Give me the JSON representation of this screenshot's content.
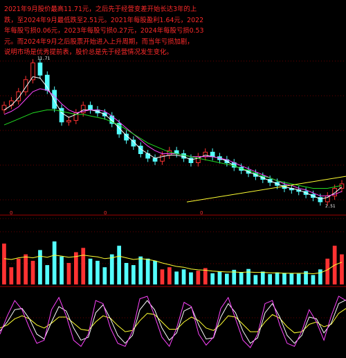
{
  "annotation": {
    "lines": [
      "2021年9月股价最高11.71元，之后先于经营变差开始长达3年的上",
      "跌，至2024年9月最低跌至2.51元。2021年每股盈利1.64元，2022",
      "年每股亏损0.06元，2023年每股亏损0.27元，2024年每股亏损0.53",
      "元。而2024年9月之后股票开始进入上升周期，而当年亏损加剧，",
      "说明市场是优秀提前表，股价总是先于经营情况发生变化。"
    ]
  },
  "chart_data": {
    "type": "line",
    "title": "",
    "price_labels": {
      "high": "11.71",
      "low": "2.51"
    },
    "year_markers": [
      "0",
      "0",
      "0"
    ],
    "price_panel": {
      "close": [
        8.9,
        9.2,
        9.8,
        10.6,
        11.71,
        10.9,
        9.9,
        8.7,
        7.8,
        7.9,
        8.4,
        8.9,
        8.6,
        8.4,
        8.2,
        7.7,
        7.0,
        6.6,
        6.2,
        5.7,
        5.4,
        5.2,
        5.6,
        5.9,
        5.7,
        5.4,
        5.1,
        5.5,
        5.8,
        5.5,
        5.3,
        5.1,
        4.8,
        4.6,
        4.4,
        4.2,
        4.0,
        3.8,
        3.6,
        3.4,
        3.3,
        3.2,
        3.0,
        2.8,
        2.51,
        2.9,
        3.4,
        3.7
      ],
      "ma_short": [
        8.6,
        8.9,
        9.4,
        10.1,
        10.8,
        10.7,
        10.1,
        9.2,
        8.4,
        8.1,
        8.3,
        8.6,
        8.6,
        8.5,
        8.3,
        7.9,
        7.4,
        6.9,
        6.5,
        6.0,
        5.7,
        5.4,
        5.5,
        5.6,
        5.6,
        5.5,
        5.3,
        5.4,
        5.6,
        5.5,
        5.4,
        5.2,
        4.9,
        4.7,
        4.5,
        4.3,
        4.1,
        3.9,
        3.7,
        3.5,
        3.4,
        3.3,
        3.1,
        2.9,
        2.7,
        2.8,
        3.1,
        3.5
      ],
      "ma_mid": [
        8.3,
        8.5,
        8.8,
        9.3,
        9.8,
        10.0,
        9.9,
        9.5,
        9.0,
        8.6,
        8.4,
        8.5,
        8.6,
        8.6,
        8.5,
        8.2,
        7.8,
        7.4,
        7.0,
        6.6,
        6.2,
        5.9,
        5.7,
        5.7,
        5.7,
        5.6,
        5.5,
        5.5,
        5.5,
        5.5,
        5.4,
        5.3,
        5.1,
        4.9,
        4.7,
        4.5,
        4.3,
        4.1,
        3.9,
        3.7,
        3.6,
        3.4,
        3.3,
        3.1,
        2.9,
        2.9,
        3.0,
        3.2
      ],
      "ma_long": [
        7.6,
        7.8,
        8.0,
        8.2,
        8.4,
        8.5,
        8.6,
        8.6,
        8.5,
        8.4,
        8.3,
        8.3,
        8.2,
        8.1,
        8.0,
        7.8,
        7.6,
        7.3,
        7.0,
        6.7,
        6.4,
        6.2,
        6.0,
        5.8,
        5.7,
        5.6,
        5.5,
        5.4,
        5.3,
        5.2,
        5.1,
        5.0,
        4.9,
        4.7,
        4.6,
        4.4,
        4.2,
        4.1,
        3.9,
        3.8,
        3.7,
        3.6,
        3.5,
        3.4,
        3.4,
        3.4,
        3.5,
        3.6
      ],
      "trend_line": {
        "start": 2.5,
        "end": 4.2
      }
    },
    "volume_panel": {
      "values": [
        95,
        40,
        60,
        70,
        55,
        80,
        45,
        100,
        65,
        50,
        75,
        85,
        60,
        55,
        40,
        70,
        90,
        50,
        45,
        65,
        60,
        55,
        35,
        40,
        30,
        35,
        28,
        32,
        38,
        26,
        30,
        25,
        34,
        29,
        36,
        22,
        30,
        24,
        28,
        27,
        26,
        25,
        31,
        22,
        35,
        60,
        90,
        70
      ],
      "ma": [
        60,
        58,
        62,
        64,
        62,
        66,
        63,
        68,
        66,
        63,
        65,
        68,
        66,
        64,
        60,
        62,
        66,
        62,
        58,
        60,
        58,
        55,
        50,
        46,
        42,
        40,
        36,
        34,
        33,
        31,
        30,
        29,
        29,
        28,
        29,
        28,
        28,
        27,
        27,
        26,
        26,
        26,
        26,
        25,
        27,
        34,
        45,
        52
      ]
    },
    "oscillator_panel": {
      "k": [
        30,
        60,
        85,
        70,
        40,
        15,
        20,
        70,
        90,
        60,
        20,
        10,
        30,
        85,
        80,
        40,
        15,
        10,
        35,
        88,
        92,
        60,
        25,
        10,
        40,
        82,
        75,
        30,
        12,
        25,
        72,
        90,
        55,
        20,
        8,
        30,
        80,
        85,
        45,
        15,
        10,
        35,
        70,
        50,
        20,
        60,
        92,
        85
      ],
      "d": [
        35,
        50,
        70,
        72,
        55,
        30,
        22,
        50,
        75,
        68,
        40,
        20,
        25,
        65,
        78,
        55,
        28,
        15,
        28,
        70,
        85,
        70,
        40,
        20,
        32,
        68,
        74,
        45,
        22,
        24,
        58,
        80,
        65,
        35,
        15,
        24,
        65,
        80,
        58,
        28,
        15,
        28,
        58,
        55,
        32,
        48,
        80,
        86
      ],
      "j": [
        40,
        45,
        55,
        60,
        55,
        45,
        40,
        48,
        58,
        58,
        48,
        38,
        36,
        50,
        60,
        56,
        44,
        34,
        36,
        52,
        64,
        62,
        50,
        38,
        38,
        50,
        58,
        52,
        40,
        36,
        46,
        60,
        58,
        46,
        34,
        34,
        50,
        62,
        56,
        42,
        32,
        34,
        46,
        50,
        42,
        46,
        64,
        72
      ]
    }
  }
}
